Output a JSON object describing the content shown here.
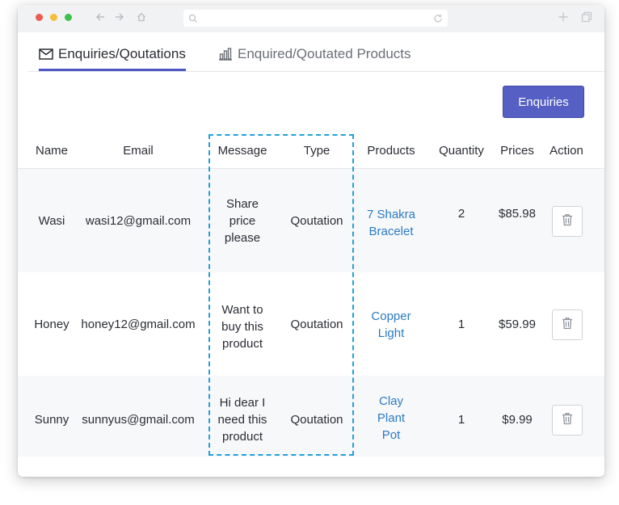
{
  "tabs": [
    {
      "label": "Enquiries/Qoutations",
      "icon": "mail-icon",
      "active": true
    },
    {
      "label": "Enquired/Qoutated Products",
      "icon": "bar-chart-icon",
      "active": false
    }
  ],
  "toolbar": {
    "enquiries_label": "Enquiries"
  },
  "table": {
    "columns": [
      "Name",
      "Email",
      "Message",
      "Type",
      "Products",
      "Quantity",
      "Prices",
      "Action"
    ],
    "rows": [
      {
        "name": "Wasi",
        "email": "wasi12@gmail.com",
        "message": [
          "Share",
          "price",
          "please"
        ],
        "type": "Qoutation",
        "product": [
          "7 Shakra",
          "Bracelet"
        ],
        "quantity": "2",
        "price": "$85.98"
      },
      {
        "name": "Honey",
        "email": "honey12@gmail.com",
        "message": [
          "Want to",
          "buy this",
          "product"
        ],
        "type": "Qoutation",
        "product": [
          "Copper",
          "Light"
        ],
        "quantity": "1",
        "price": "$59.99"
      },
      {
        "name": "Sunny",
        "email": "sunnyus@gmail.com",
        "message": [
          "Hi dear I",
          "need this",
          "product"
        ],
        "type": "Qoutation",
        "product": [
          "Clay",
          "Plant",
          "Pot"
        ],
        "quantity": "1",
        "price": "$9.99"
      }
    ]
  },
  "colors": {
    "accent": "#5660c4",
    "link": "#2c7bc4",
    "highlight": "#21a0d8"
  }
}
